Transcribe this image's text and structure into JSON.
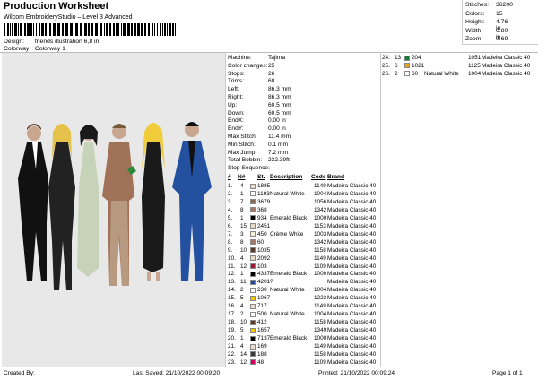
{
  "header": {
    "title": "Production Worksheet",
    "subtitle": "Wilcom EmbroideryStudio – Level 3 Advanced",
    "design_label": "Design:",
    "design_value": "friends illustration 6,8 in",
    "colorway_label": "Colorway:",
    "colorway_value": "Colorway 1"
  },
  "stats": [
    {
      "label": "Stitches:",
      "value": "36200"
    },
    {
      "label": "Colors:",
      "value": "15"
    },
    {
      "label": "Height:",
      "value": "4.76 in"
    },
    {
      "label": "Width:",
      "value": "6.80 in"
    },
    {
      "label": "Zoom:",
      "value": "0.69"
    }
  ],
  "machine": [
    {
      "label": "Machine:",
      "value": "Tajima"
    },
    {
      "label": "Color changes:",
      "value": "25"
    },
    {
      "label": "Stops:",
      "value": "26"
    },
    {
      "label": "Trims:",
      "value": "68"
    },
    {
      "label": "Left:",
      "value": "86.3 mm"
    },
    {
      "label": "Right:",
      "value": "86.3 mm"
    },
    {
      "label": "Up:",
      "value": "60.5 mm"
    },
    {
      "label": "Down:",
      "value": "60.5 mm"
    },
    {
      "label": "EndX:",
      "value": "0.00 in"
    },
    {
      "label": "EndY:",
      "value": "0.00 in"
    },
    {
      "label": "Max Stitch:",
      "value": "11.4 mm"
    },
    {
      "label": "Min Stitch:",
      "value": "0.1 mm"
    },
    {
      "label": "Max Jump:",
      "value": "7.2 mm"
    },
    {
      "label": "Total Bobbin:",
      "value": "232.39ft"
    }
  ],
  "sequence_title": "Stop Sequence:",
  "headers": {
    "num": "#",
    "n": "N#",
    "st": "St.",
    "desc": "Description",
    "code": "Code",
    "brand": "Brand"
  },
  "sequence": [
    {
      "num": "1.",
      "n": "4",
      "color": "#e8dccd",
      "st": "1885",
      "desc": "",
      "code": "1149",
      "brand": "Madeira Classic 40"
    },
    {
      "num": "2.",
      "n": "1",
      "color": "#ffffff",
      "st": "1193",
      "desc": "Natural White",
      "code": "1004",
      "brand": "Madeira Classic 40"
    },
    {
      "num": "3.",
      "n": "7",
      "color": "#8a6a4c",
      "st": "3679",
      "desc": "",
      "code": "1056",
      "brand": "Madeira Classic 40"
    },
    {
      "num": "4.",
      "n": "8",
      "color": "#a37a66",
      "st": "368",
      "desc": "",
      "code": "1342",
      "brand": "Madeira Classic 40"
    },
    {
      "num": "5.",
      "n": "1",
      "color": "#000000",
      "st": "934",
      "desc": "Emerald Black",
      "code": "1000",
      "brand": "Madeira Classic 40"
    },
    {
      "num": "6.",
      "n": "15",
      "color": "#e8dccd",
      "st": "2451",
      "desc": "",
      "code": "1153",
      "brand": "Madeira Classic 40"
    },
    {
      "num": "7.",
      "n": "3",
      "color": "#f2eedc",
      "st": "450",
      "desc": "Crème White",
      "code": "1003",
      "brand": "Madeira Classic 40"
    },
    {
      "num": "8.",
      "n": "8",
      "color": "#a37a66",
      "st": "60",
      "desc": "",
      "code": "1342",
      "brand": "Madeira Classic 40"
    },
    {
      "num": "9.",
      "n": "10",
      "color": "#5c3a2a",
      "st": "1035",
      "desc": "",
      "code": "1158",
      "brand": "Madeira Classic 40"
    },
    {
      "num": "10.",
      "n": "4",
      "color": "#e8dccd",
      "st": "2092",
      "desc": "",
      "code": "1149",
      "brand": "Madeira Classic 40"
    },
    {
      "num": "11.",
      "n": "12",
      "color": "#9c1a33",
      "st": "103",
      "desc": "",
      "code": "1109",
      "brand": "Madeira Classic 40"
    },
    {
      "num": "12.",
      "n": "1",
      "color": "#000000",
      "st": "4337",
      "desc": "Emerald Black",
      "code": "1000",
      "brand": "Madeira Classic 40"
    },
    {
      "num": "13.",
      "n": "11",
      "color": "#1f4a9e",
      "st": "4201",
      "desc": "?",
      "code": "",
      "brand": "Madeira Classic 40"
    },
    {
      "num": "14.",
      "n": "2",
      "color": "#ffffff",
      "st": "230",
      "desc": "Natural White",
      "code": "1004",
      "brand": "Madeira Classic 40"
    },
    {
      "num": "15.",
      "n": "5",
      "color": "#f2c500",
      "st": "1067",
      "desc": "",
      "code": "1223",
      "brand": "Madeira Classic 40"
    },
    {
      "num": "16.",
      "n": "4",
      "color": "#e8dccd",
      "st": "717",
      "desc": "",
      "code": "1149",
      "brand": "Madeira Classic 40"
    },
    {
      "num": "17.",
      "n": "2",
      "color": "#ffffff",
      "st": "500",
      "desc": "Natural White",
      "code": "1004",
      "brand": "Madeira Classic 40"
    },
    {
      "num": "18.",
      "n": "10",
      "color": "#5c3a2a",
      "st": "412",
      "desc": "",
      "code": "1158",
      "brand": "Madeira Classic 40"
    },
    {
      "num": "19.",
      "n": "5",
      "color": "#f2c500",
      "st": "1657",
      "desc": "",
      "code": "1349",
      "brand": "Madeira Classic 40"
    },
    {
      "num": "20.",
      "n": "1",
      "color": "#000000",
      "st": "7137",
      "desc": "Emerald Black",
      "code": "1000",
      "brand": "Madeira Classic 40"
    },
    {
      "num": "21.",
      "n": "4",
      "color": "#e8dccd",
      "st": "169",
      "desc": "",
      "code": "1149",
      "brand": "Madeira Classic 40"
    },
    {
      "num": "22.",
      "n": "14",
      "color": "#3a3a3a",
      "st": "188",
      "desc": "",
      "code": "1158",
      "brand": "Madeira Classic 40"
    },
    {
      "num": "23.",
      "n": "12",
      "color": "#d4005c",
      "st": "48",
      "desc": "",
      "code": "1109",
      "brand": "Madeira Classic 40"
    },
    {
      "num": "24.",
      "n": "13",
      "color": "#1a7a3a",
      "st": "204",
      "desc": "",
      "code": "1051",
      "brand": "Madeira Classic 40"
    },
    {
      "num": "25.",
      "n": "6",
      "color": "#e8a020",
      "st": "1021",
      "desc": "",
      "code": "1125",
      "brand": "Madeira Classic 40"
    },
    {
      "num": "26.",
      "n": "2",
      "color": "#ffffff",
      "st": "60",
      "desc": "Natural White",
      "code": "1004",
      "brand": "Madeira Classic 40"
    }
  ],
  "footer": {
    "created_by": "Created By:",
    "last_saved": "Last Saved: 21/10/2022 00:09:20",
    "printed": "Printed: 21/10/2022 00:09:24",
    "page": "Page 1 of 1"
  }
}
